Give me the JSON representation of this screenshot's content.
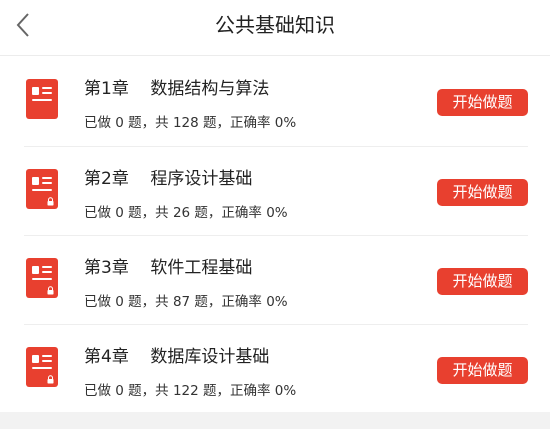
{
  "header": {
    "title": "公共基础知识",
    "back_icon": "chevron-left-icon"
  },
  "chapters": [
    {
      "title": "第1章    数据结构与算法",
      "stats": "已做 0 题，共 128 题，正确率 0%",
      "button_label": "开始做题",
      "locked": false
    },
    {
      "title": "第2章    程序设计基础",
      "stats": "已做 0 题，共 26 题，正确率 0%",
      "button_label": "开始做题",
      "locked": true
    },
    {
      "title": "第3章    软件工程基础",
      "stats": "已做 0 题，共 87 题，正确率 0%",
      "button_label": "开始做题",
      "locked": true
    },
    {
      "title": "第4章    数据库设计基础",
      "stats": "已做 0 题，共 122 题，正确率 0%",
      "button_label": "开始做题",
      "locked": true
    }
  ],
  "colors": {
    "accent": "#e8402f",
    "divider": "#eeeeee",
    "footer": "#f2f2f2"
  }
}
